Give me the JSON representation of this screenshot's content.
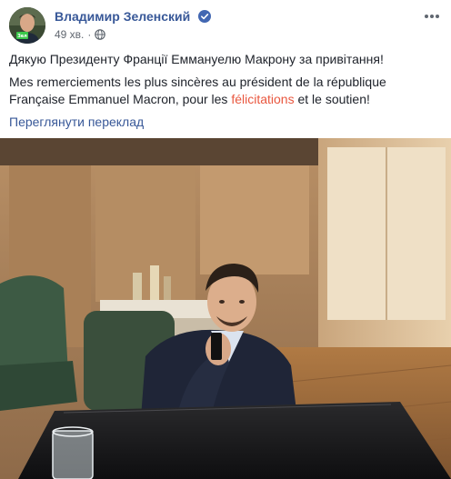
{
  "post": {
    "author_name": "Владимир Зеленский",
    "time": "49 хв.",
    "meta_separator": "·",
    "message_uk": "Дякую Президенту Франції Еммануелю Макрону за привітання!",
    "message_fr_part1": "Mes remerciements les plus sincères au président de la république Française Emmanuel Macron, pour les ",
    "message_fr_highlight": "félicitations",
    "message_fr_part2": " et le soutien!",
    "translate_label": "Переглянути переклад",
    "avatar_badge_text": "Зел",
    "icons": {
      "verified": "verified-badge-icon",
      "privacy": "globe-icon",
      "more": "more-options-icon"
    },
    "colors": {
      "author_link": "#385898",
      "meta_text": "#616770",
      "body_text": "#1d2129",
      "highlight": "#e9573f",
      "verified_blue": "#4267b2"
    }
  }
}
